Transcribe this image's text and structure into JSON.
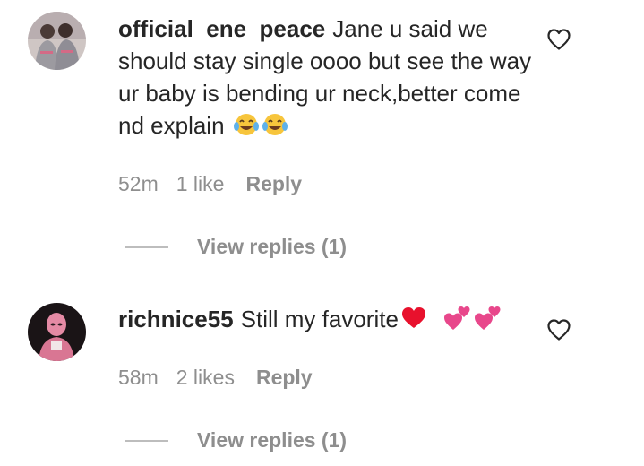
{
  "comments": [
    {
      "username": "official_ene_peace",
      "text": "Jane u said we should stay single oooo but see the way ur baby is bending ur neck,better come nd explain",
      "emojis": [
        "face-with-tears-of-joy",
        "face-with-tears-of-joy"
      ],
      "time": "52m",
      "likes": "1 like",
      "reply_label": "Reply",
      "view_replies": "View replies (1)",
      "avatar": "two-women-in-grey-hoodies-photo"
    },
    {
      "username": "richnice55",
      "text": "Still my favorite",
      "emojis": [
        "red-heart",
        "two-hearts",
        "two-hearts"
      ],
      "time": "58m",
      "likes": "2 likes",
      "reply_label": "Reply",
      "view_replies": "View replies (1)",
      "avatar": "person-in-pink-mask-photo"
    }
  ],
  "icons": {
    "like": "heart-outline-icon"
  },
  "colors": {
    "text": "#262626",
    "secondary": "#8e8e8e",
    "divider": "#bdbdbd",
    "heart_red": "#e8112d",
    "heart_pink": "#e8478b"
  }
}
